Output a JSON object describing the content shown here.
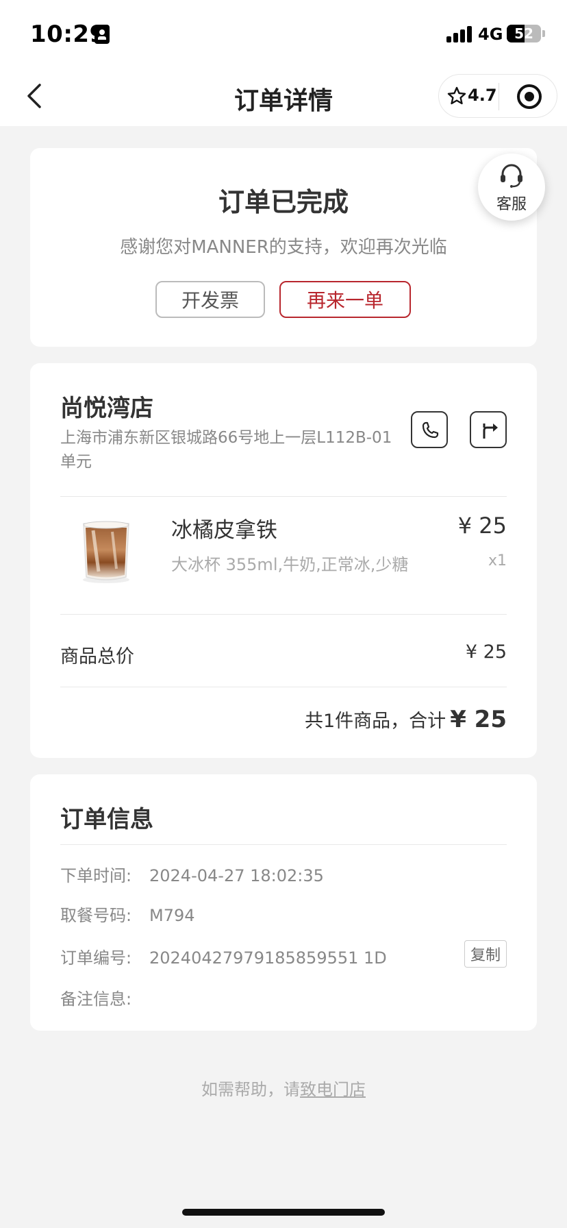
{
  "status_bar": {
    "time": "10:29",
    "network": "4G",
    "battery": "52",
    "battery_level": 0.52
  },
  "nav": {
    "title": "订单详情",
    "rating": "4.7",
    "icons": [
      "back-arrow-icon",
      "star-icon",
      "target-icon"
    ]
  },
  "order_status": {
    "title": "订单已完成",
    "subtitle": "感谢您对MANNER的支持，欢迎再次光临",
    "invoice_label": "开发票",
    "reorder_label": "再来一单",
    "accent_color": "#b8262d"
  },
  "customer_service": {
    "label": "客服",
    "icon": "headset-icon"
  },
  "store": {
    "name": "尚悦湾店",
    "address": "上海市浦东新区银城路66号地上一层L112B-01单元",
    "actions": [
      "phone-icon",
      "directions-icon"
    ]
  },
  "item": {
    "name": "冰橘皮拿铁",
    "spec": "大冰杯 355ml,牛奶,正常冰,少糖",
    "price": "¥ 25",
    "qty": "x1"
  },
  "summary": {
    "subtotal_label": "商品总价",
    "subtotal_value": "¥ 25",
    "total_prefix": "共1件商品，合计",
    "total_value": "¥ 25"
  },
  "order_info": {
    "title": "订单信息",
    "rows": [
      {
        "label": "下单时间:",
        "value": "2024-04-27 18:02:35"
      },
      {
        "label": "取餐号码:",
        "value": "M794"
      },
      {
        "label": "订单编号:",
        "value": "20240427979185859551 1D"
      },
      {
        "label": "备注信息:",
        "value": ""
      }
    ],
    "copy_label": "复制"
  },
  "help": {
    "prefix": "如需帮助，请",
    "link": "致电门店"
  }
}
